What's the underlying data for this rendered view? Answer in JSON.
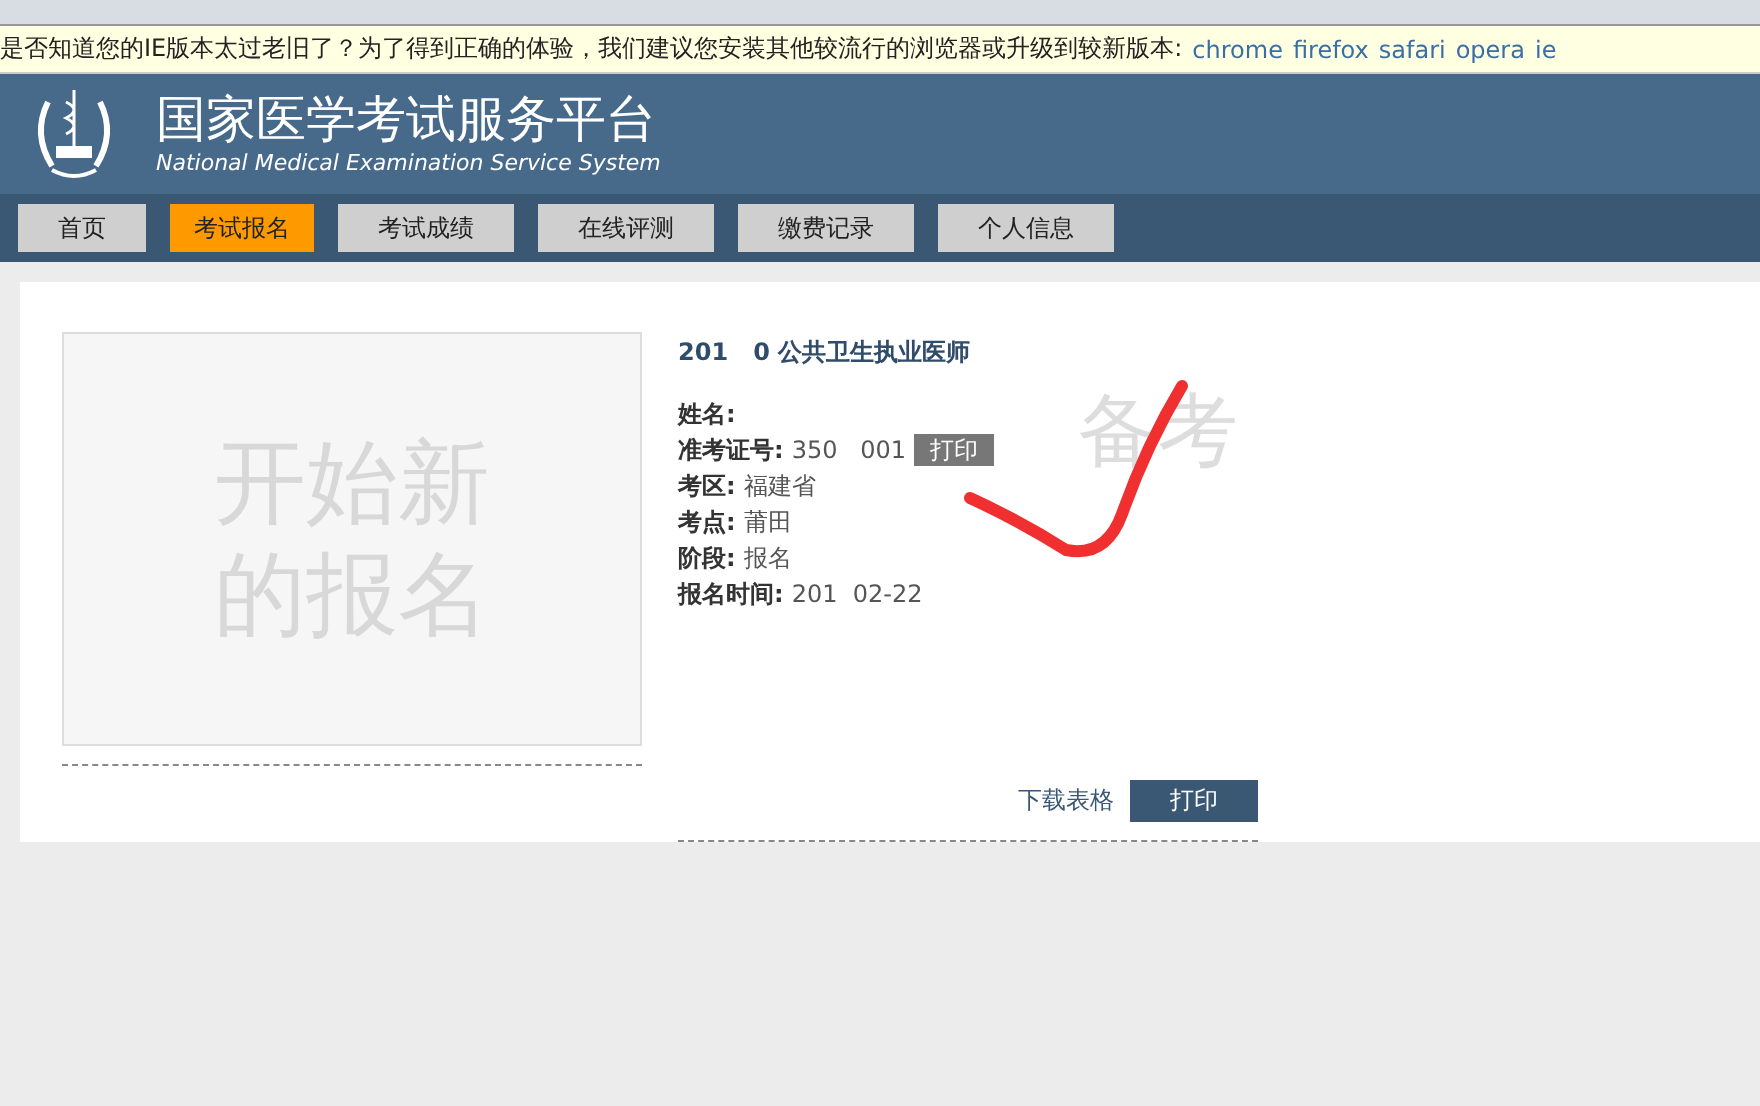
{
  "notice": {
    "text": "是否知道您的IE版本太过老旧了？为了得到正确的体验，我们建议您安装其他较流行的浏览器或升级到较新版本:",
    "browsers": [
      "chrome",
      "firefox",
      "safari",
      "opera",
      "ie"
    ]
  },
  "header": {
    "title": "国家医学考试服务平台",
    "subtitle": "National Medical Examination Service System"
  },
  "nav": [
    {
      "label": "首页",
      "selected": false
    },
    {
      "label": "考试报名",
      "selected": true
    },
    {
      "label": "考试成绩",
      "selected": false
    },
    {
      "label": "在线评测",
      "selected": false
    },
    {
      "label": "缴费记录",
      "selected": false
    },
    {
      "label": "个人信息",
      "selected": false
    }
  ],
  "new_registration": {
    "text": "开始新的报名"
  },
  "exam": {
    "title": "201   0 公共卫生执业医师",
    "stamp": "备考",
    "fields": [
      {
        "label": "姓名:"
      },
      {
        "label": "准考证号:",
        "value": "350   001",
        "action": "打印"
      },
      {
        "label": "考区:",
        "value": "福建省"
      },
      {
        "label": "考点:",
        "value": "莆田"
      },
      {
        "label": "阶段:",
        "value": "报名"
      },
      {
        "label": "报名时间:",
        "value": "201  02-22"
      }
    ],
    "download": "下载表格",
    "print": "打印"
  }
}
